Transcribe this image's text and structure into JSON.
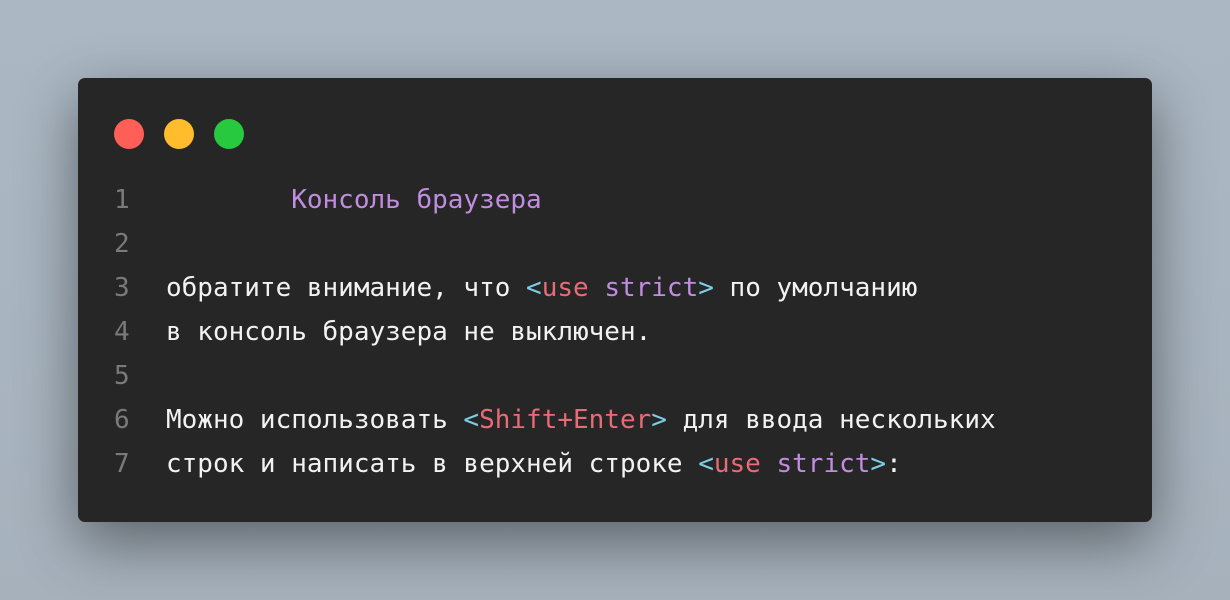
{
  "window": {
    "controls": [
      {
        "name": "close",
        "color": "#ff5f56"
      },
      {
        "name": "minimize",
        "color": "#ffbd2e"
      },
      {
        "name": "maximize",
        "color": "#27c93f"
      }
    ]
  },
  "colors": {
    "title": "#c28ce0",
    "bracket": "#7ccfe6",
    "keyword": "#ea6b78",
    "string": "#c28ce0",
    "plain": "#f2f2f2",
    "line_number": "#7a7a7a"
  },
  "lines": [
    {
      "number": "1",
      "tokens": [
        {
          "text": "        Консоль браузера",
          "style": "title"
        }
      ]
    },
    {
      "number": "2",
      "tokens": []
    },
    {
      "number": "3",
      "tokens": [
        {
          "text": "обратите внимание, что ",
          "style": "plain"
        },
        {
          "text": "<",
          "style": "bracket"
        },
        {
          "text": "use",
          "style": "keyword"
        },
        {
          "text": " ",
          "style": "plain"
        },
        {
          "text": "strict",
          "style": "string"
        },
        {
          "text": ">",
          "style": "bracket"
        },
        {
          "text": " по умолчанию",
          "style": "plain"
        }
      ]
    },
    {
      "number": "4",
      "tokens": [
        {
          "text": "в консоль браузера не выключен.",
          "style": "plain"
        }
      ]
    },
    {
      "number": "5",
      "tokens": []
    },
    {
      "number": "6",
      "tokens": [
        {
          "text": "Можно использовать ",
          "style": "plain"
        },
        {
          "text": "<",
          "style": "bracket"
        },
        {
          "text": "Shift+Enter",
          "style": "keyword"
        },
        {
          "text": ">",
          "style": "bracket"
        },
        {
          "text": " для ввода нескольких",
          "style": "plain"
        }
      ]
    },
    {
      "number": "7",
      "tokens": [
        {
          "text": "строк и написать в верхней строке ",
          "style": "plain"
        },
        {
          "text": "<",
          "style": "bracket"
        },
        {
          "text": "use",
          "style": "keyword"
        },
        {
          "text": " ",
          "style": "plain"
        },
        {
          "text": "strict",
          "style": "string"
        },
        {
          "text": ">",
          "style": "bracket"
        },
        {
          "text": ":",
          "style": "plain"
        }
      ]
    }
  ]
}
